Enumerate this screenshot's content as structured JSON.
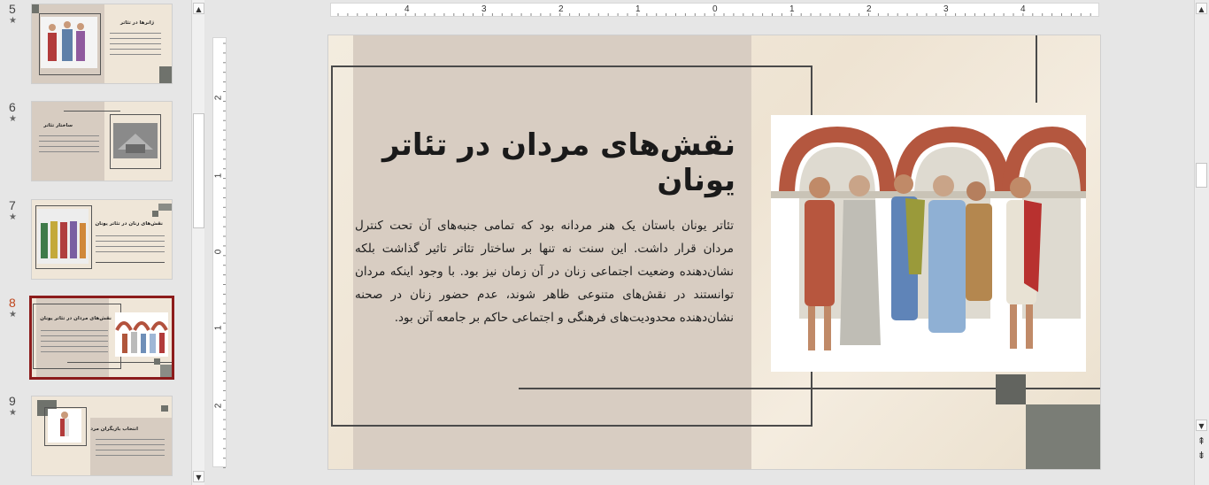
{
  "thumbnails": [
    {
      "number": "5",
      "star": "★",
      "title": "ژانرها در تئاتر"
    },
    {
      "number": "6",
      "star": "★",
      "title": "ساختار تئاتر"
    },
    {
      "number": "7",
      "star": "★",
      "title": "نقش‌های زنان در تئاتر یونان"
    },
    {
      "number": "8",
      "star": "★",
      "title": "نقش‌های مردان در تئاتر یونان",
      "selected": true
    },
    {
      "number": "9",
      "star": "★",
      "title": "انتخاب بازیگران مرد"
    }
  ],
  "ruler": {
    "h_labels": [
      "4",
      "3",
      "2",
      "1",
      "0",
      "1",
      "2",
      "3",
      "4"
    ],
    "v_labels": [
      "2",
      "1",
      "0",
      "1",
      "2"
    ]
  },
  "slide": {
    "title": "نقش‌های مردان در تئاتر یونان",
    "body": "تئاتر یونان باستان یک هنر مردانه بود که تمامی جنبه‌های آن تحت کنترل مردان قرار داشت. این سنت نه تنها بر ساختار تئاتر تاثیر گذاشت بلکه نشان‌دهنده وضعیت اجتماعی زنان در آن زمان نیز بود. با وجود اینکه مردان توانستند در نقش‌های متنوعی ظاهر شوند، عدم حضور زنان در صحنه نشان‌دهنده محدودیت‌های فرهنگی و اجتماعی حاکم بر جامعه آتن بود."
  },
  "icons": {
    "scroll_up": "▲",
    "scroll_down": "▼",
    "prev_slide": "⇞",
    "next_slide": "⇟"
  },
  "colors": {
    "selection": "#8c1b1b",
    "active_number": "#c0461c",
    "tan_panel": "#d8cdc2",
    "dark_square": "#62645f"
  }
}
